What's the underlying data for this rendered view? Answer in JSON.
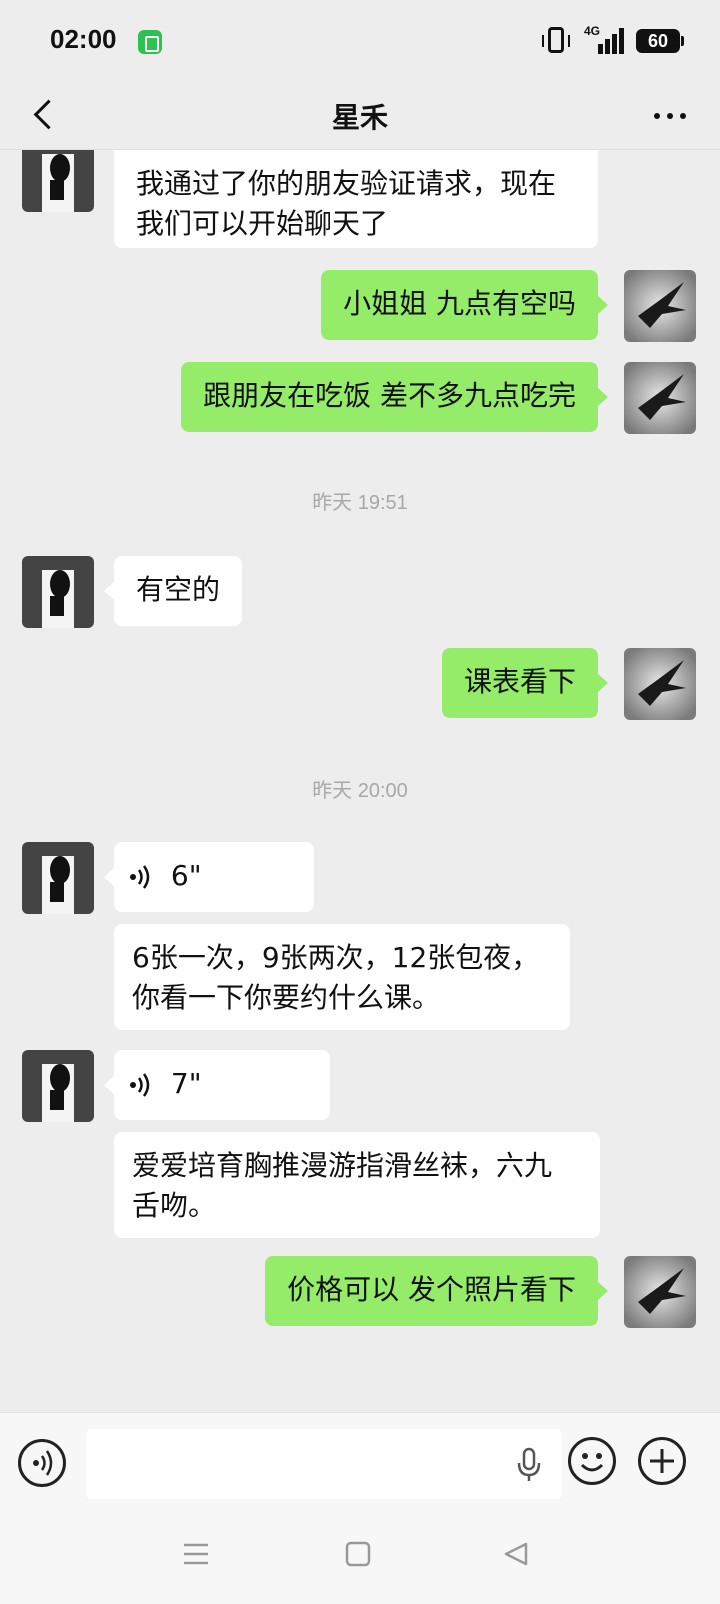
{
  "status_bar": {
    "time": "02:00",
    "network": "4G",
    "battery": "60"
  },
  "header": {
    "title": "星禾"
  },
  "messages": [
    {
      "side": "in",
      "text_lines": [
        "我通过了你的朋友验证请求，现在",
        "我们可以开始聊天了"
      ]
    },
    {
      "side": "out",
      "text": "小姐姐 九点有空吗"
    },
    {
      "side": "out",
      "text": "跟朋友在吃饭 差不多九点吃完"
    },
    {
      "type": "timestamp",
      "text": "昨天 19:51"
    },
    {
      "side": "in",
      "text": "有空的"
    },
    {
      "side": "out",
      "text": "课表看下"
    },
    {
      "type": "timestamp",
      "text": "昨天 20:00"
    },
    {
      "side": "in",
      "type": "voice",
      "duration": "6\""
    },
    {
      "side": "in",
      "text_lines": [
        "6张一次，9张两次，12张包夜，",
        "你看一下你要约什么课。"
      ]
    },
    {
      "side": "in",
      "type": "voice",
      "duration": "7\""
    },
    {
      "side": "in",
      "text_lines": [
        "爱爱培育胸推漫游指滑丝袜，六九",
        "舌吻。"
      ]
    },
    {
      "side": "out",
      "text": "价格可以 发个照片看下"
    }
  ],
  "icons": {
    "back": "back-arrow-icon",
    "more": "more-dots-icon",
    "voice_mode": "voice-input-icon",
    "mic": "microphone-icon",
    "emoji": "emoji-icon",
    "add": "plus-icon"
  },
  "colors": {
    "outgoing_bubble": "#95ec69",
    "incoming_bubble": "#ffffff",
    "background": "#ededed"
  }
}
